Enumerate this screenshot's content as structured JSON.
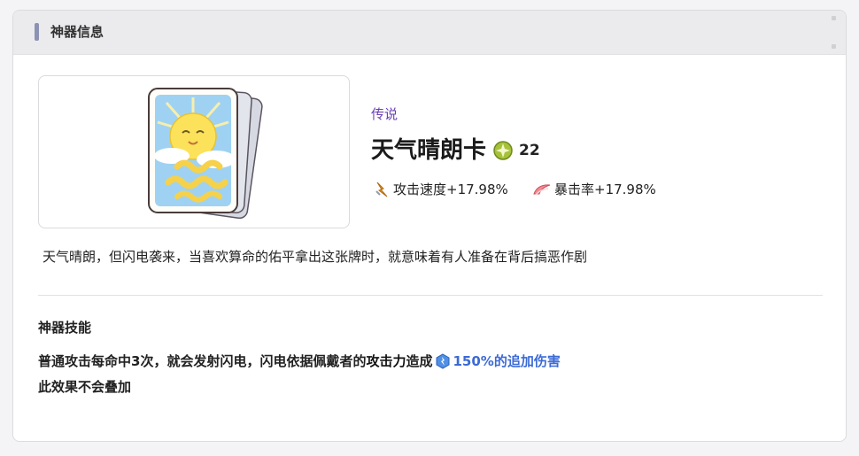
{
  "header": {
    "title": "神器信息"
  },
  "artifact": {
    "rarity": "传说",
    "name": "天气晴朗卡",
    "level": "22",
    "stats": [
      {
        "label": "攻击速度+17.98%",
        "icon": "attack-speed-icon"
      },
      {
        "label": "暴击率+17.98%",
        "icon": "crit-rate-icon"
      }
    ],
    "description": "天气晴朗，但闪电袭来，当喜欢算命的佑平拿出这张牌时，就意味着有人准备在背后搞恶作剧"
  },
  "skill": {
    "title": "神器技能",
    "line1_prefix": "普通攻击每命中3次，就会发射闪电，闪电依据佩戴者的",
    "line1_keyword": "攻击力",
    "line1_mid": "造成",
    "line1_damage": "150%的追加伤害",
    "line2": "此效果不会叠加"
  },
  "colors": {
    "rarity": "#6a3fb4",
    "damage": "#3b6ad6",
    "header_accent": "#8c92b3"
  }
}
